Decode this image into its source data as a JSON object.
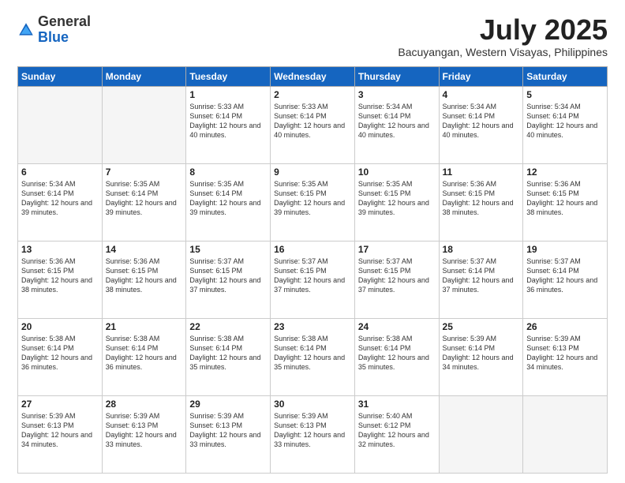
{
  "header": {
    "logo_general": "General",
    "logo_blue": "Blue",
    "month_title": "July 2025",
    "location": "Bacuyangan, Western Visayas, Philippines"
  },
  "days_of_week": [
    "Sunday",
    "Monday",
    "Tuesday",
    "Wednesday",
    "Thursday",
    "Friday",
    "Saturday"
  ],
  "weeks": [
    [
      {
        "day": "",
        "empty": true
      },
      {
        "day": "",
        "empty": true
      },
      {
        "day": "1",
        "sunrise": "5:33 AM",
        "sunset": "6:14 PM",
        "daylight": "12 hours and 40 minutes."
      },
      {
        "day": "2",
        "sunrise": "5:33 AM",
        "sunset": "6:14 PM",
        "daylight": "12 hours and 40 minutes."
      },
      {
        "day": "3",
        "sunrise": "5:34 AM",
        "sunset": "6:14 PM",
        "daylight": "12 hours and 40 minutes."
      },
      {
        "day": "4",
        "sunrise": "5:34 AM",
        "sunset": "6:14 PM",
        "daylight": "12 hours and 40 minutes."
      },
      {
        "day": "5",
        "sunrise": "5:34 AM",
        "sunset": "6:14 PM",
        "daylight": "12 hours and 40 minutes."
      }
    ],
    [
      {
        "day": "6",
        "sunrise": "5:34 AM",
        "sunset": "6:14 PM",
        "daylight": "12 hours and 39 minutes."
      },
      {
        "day": "7",
        "sunrise": "5:35 AM",
        "sunset": "6:14 PM",
        "daylight": "12 hours and 39 minutes."
      },
      {
        "day": "8",
        "sunrise": "5:35 AM",
        "sunset": "6:14 PM",
        "daylight": "12 hours and 39 minutes."
      },
      {
        "day": "9",
        "sunrise": "5:35 AM",
        "sunset": "6:15 PM",
        "daylight": "12 hours and 39 minutes."
      },
      {
        "day": "10",
        "sunrise": "5:35 AM",
        "sunset": "6:15 PM",
        "daylight": "12 hours and 39 minutes."
      },
      {
        "day": "11",
        "sunrise": "5:36 AM",
        "sunset": "6:15 PM",
        "daylight": "12 hours and 38 minutes."
      },
      {
        "day": "12",
        "sunrise": "5:36 AM",
        "sunset": "6:15 PM",
        "daylight": "12 hours and 38 minutes."
      }
    ],
    [
      {
        "day": "13",
        "sunrise": "5:36 AM",
        "sunset": "6:15 PM",
        "daylight": "12 hours and 38 minutes."
      },
      {
        "day": "14",
        "sunrise": "5:36 AM",
        "sunset": "6:15 PM",
        "daylight": "12 hours and 38 minutes."
      },
      {
        "day": "15",
        "sunrise": "5:37 AM",
        "sunset": "6:15 PM",
        "daylight": "12 hours and 37 minutes."
      },
      {
        "day": "16",
        "sunrise": "5:37 AM",
        "sunset": "6:15 PM",
        "daylight": "12 hours and 37 minutes."
      },
      {
        "day": "17",
        "sunrise": "5:37 AM",
        "sunset": "6:15 PM",
        "daylight": "12 hours and 37 minutes."
      },
      {
        "day": "18",
        "sunrise": "5:37 AM",
        "sunset": "6:14 PM",
        "daylight": "12 hours and 37 minutes."
      },
      {
        "day": "19",
        "sunrise": "5:37 AM",
        "sunset": "6:14 PM",
        "daylight": "12 hours and 36 minutes."
      }
    ],
    [
      {
        "day": "20",
        "sunrise": "5:38 AM",
        "sunset": "6:14 PM",
        "daylight": "12 hours and 36 minutes."
      },
      {
        "day": "21",
        "sunrise": "5:38 AM",
        "sunset": "6:14 PM",
        "daylight": "12 hours and 36 minutes."
      },
      {
        "day": "22",
        "sunrise": "5:38 AM",
        "sunset": "6:14 PM",
        "daylight": "12 hours and 35 minutes."
      },
      {
        "day": "23",
        "sunrise": "5:38 AM",
        "sunset": "6:14 PM",
        "daylight": "12 hours and 35 minutes."
      },
      {
        "day": "24",
        "sunrise": "5:38 AM",
        "sunset": "6:14 PM",
        "daylight": "12 hours and 35 minutes."
      },
      {
        "day": "25",
        "sunrise": "5:39 AM",
        "sunset": "6:14 PM",
        "daylight": "12 hours and 34 minutes."
      },
      {
        "day": "26",
        "sunrise": "5:39 AM",
        "sunset": "6:13 PM",
        "daylight": "12 hours and 34 minutes."
      }
    ],
    [
      {
        "day": "27",
        "sunrise": "5:39 AM",
        "sunset": "6:13 PM",
        "daylight": "12 hours and 34 minutes."
      },
      {
        "day": "28",
        "sunrise": "5:39 AM",
        "sunset": "6:13 PM",
        "daylight": "12 hours and 33 minutes."
      },
      {
        "day": "29",
        "sunrise": "5:39 AM",
        "sunset": "6:13 PM",
        "daylight": "12 hours and 33 minutes."
      },
      {
        "day": "30",
        "sunrise": "5:39 AM",
        "sunset": "6:13 PM",
        "daylight": "12 hours and 33 minutes."
      },
      {
        "day": "31",
        "sunrise": "5:40 AM",
        "sunset": "6:12 PM",
        "daylight": "12 hours and 32 minutes."
      },
      {
        "day": "",
        "empty": true
      },
      {
        "day": "",
        "empty": true
      }
    ]
  ]
}
